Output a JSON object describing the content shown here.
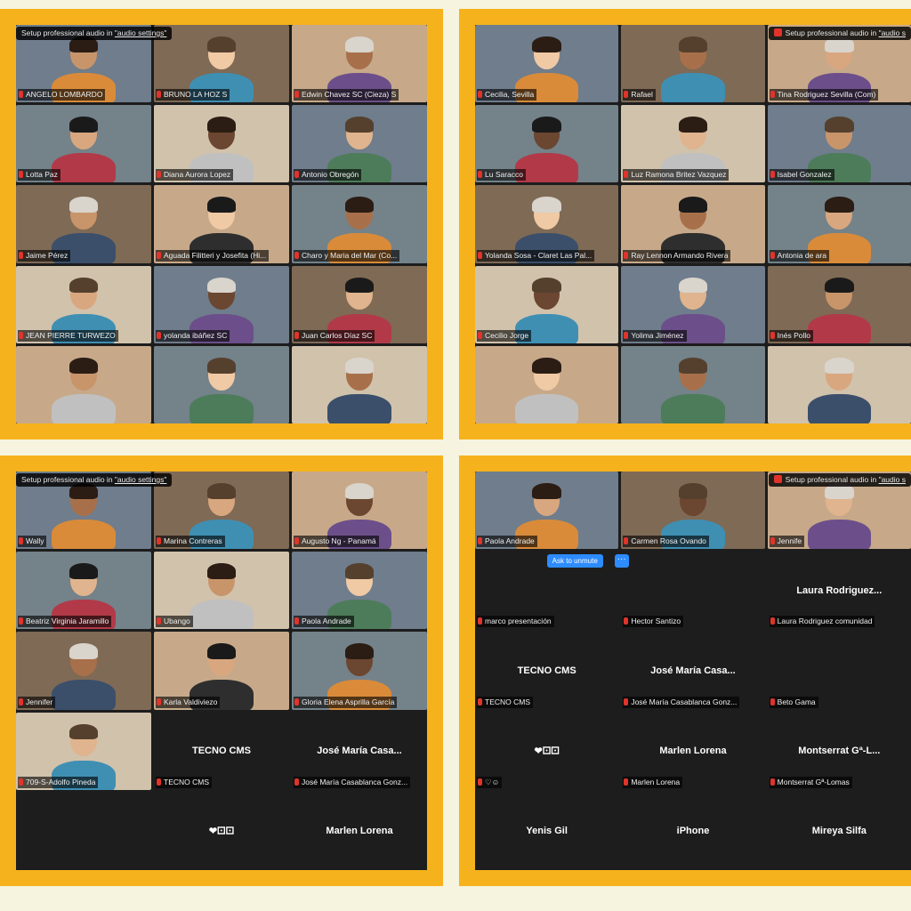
{
  "colors": {
    "frame": "#f6b21c",
    "background": "#f6f4df",
    "zoom_bg": "#1d1d1d",
    "accent": "#2d8cff",
    "muted": "#e0342b"
  },
  "q1": {
    "banner_prefix": "Setup professional audio in ",
    "banner_link": "\"audio settings\"",
    "tiles": [
      {
        "name": "ANGELO LOMBARDO"
      },
      {
        "name": "BRUNO LA HOZ S"
      },
      {
        "name": "Edwin Chavez SC (Cieza) S"
      },
      {
        "name": "Lotta Paz"
      },
      {
        "name": "Diana Aurora Lopez"
      },
      {
        "name": "Antonio Obregón"
      },
      {
        "name": "Jaime Pérez"
      },
      {
        "name": "Aguada Filitteri y Josefita (Hi..."
      },
      {
        "name": "Charo y Maria del Mar (Co..."
      },
      {
        "name": "JEAN PIERRE TURWEZO"
      },
      {
        "name": "yolanda ibáñez SC"
      },
      {
        "name": "Juan Carlos Díaz SC"
      },
      {
        "name": ""
      },
      {
        "name": ""
      },
      {
        "name": ""
      }
    ]
  },
  "q2": {
    "banner_prefix": "Setup professional audio in ",
    "banner_link": "\"audio s",
    "tiles": [
      {
        "name": "Cecilia, Sevilla"
      },
      {
        "name": "Rafael"
      },
      {
        "name": "Tina Rodriguez Sevilla (Com)"
      },
      {
        "name": "Lu Saracco"
      },
      {
        "name": "Luz Ramona Britez Vazquez"
      },
      {
        "name": "Isabel Gonzalez"
      },
      {
        "name": "Yolanda Sosa - Claret Las Pal..."
      },
      {
        "name": "Ray Lennon Armando Rivera"
      },
      {
        "name": "Antonia de ara"
      },
      {
        "name": "Cecilio Jorge"
      },
      {
        "name": "Yolima Jiménez"
      },
      {
        "name": "Inés Pollo"
      },
      {
        "name": ""
      },
      {
        "name": ""
      },
      {
        "name": ""
      }
    ]
  },
  "q3": {
    "banner_prefix": "Setup professional audio in ",
    "banner_link": "\"audio settings\"",
    "tiles": [
      {
        "name": "Wally"
      },
      {
        "name": "Marina Contreras"
      },
      {
        "name": "Augusto Ng - Panamá"
      },
      {
        "name": "Beatriz Virginia Jaramillo"
      },
      {
        "name": "Ubango"
      },
      {
        "name": "Paola Andrade"
      },
      {
        "name": "Jennifer"
      },
      {
        "name": "Karla Valdiviezo"
      },
      {
        "name": "Gloria Elena Asprilla García"
      },
      {
        "name": "709-S-Adolfo Pineda"
      },
      {
        "name": "TECNO CMS",
        "big": "TECNO CMS"
      },
      {
        "name": "José María Casablanca Gonz...",
        "big": "José María Casa..."
      },
      {
        "name": ""
      },
      {
        "name": "",
        "big": "❤︎⚀⚀"
      },
      {
        "name": "",
        "big": "Marlen Lorena"
      }
    ]
  },
  "q4": {
    "banner_prefix": "Setup professional audio in ",
    "banner_link": "\"audio s",
    "ask_unmute": "Ask to unmute",
    "more": "···",
    "tiles": [
      {
        "name": "Paola Andrade"
      },
      {
        "name": "Carmen Rosa Ovando"
      },
      {
        "name": "Jennife"
      },
      {
        "name": "marco presentación"
      },
      {
        "name": "Hector Santizo"
      },
      {
        "name": "Laura Rodriguez comunidad",
        "big": "Laura Rodriguez..."
      },
      {
        "name": "TECNO CMS",
        "big": "TECNO CMS"
      },
      {
        "name": "José María Casablanca Gonz...",
        "big": "José María Casa..."
      },
      {
        "name": "Beto Gama"
      },
      {
        "name": "♡☺",
        "big": "❤︎⚀⚀"
      },
      {
        "name": "Marlen Lorena",
        "big": "Marlen Lorena"
      },
      {
        "name": "Montserrat Gª-Lomas",
        "big": "Montserrat Gª-L..."
      },
      {
        "name": "",
        "big": "Yenis Gil"
      },
      {
        "name": "",
        "big": "iPhone"
      },
      {
        "name": "",
        "big": "Mireya Silfa"
      }
    ]
  }
}
